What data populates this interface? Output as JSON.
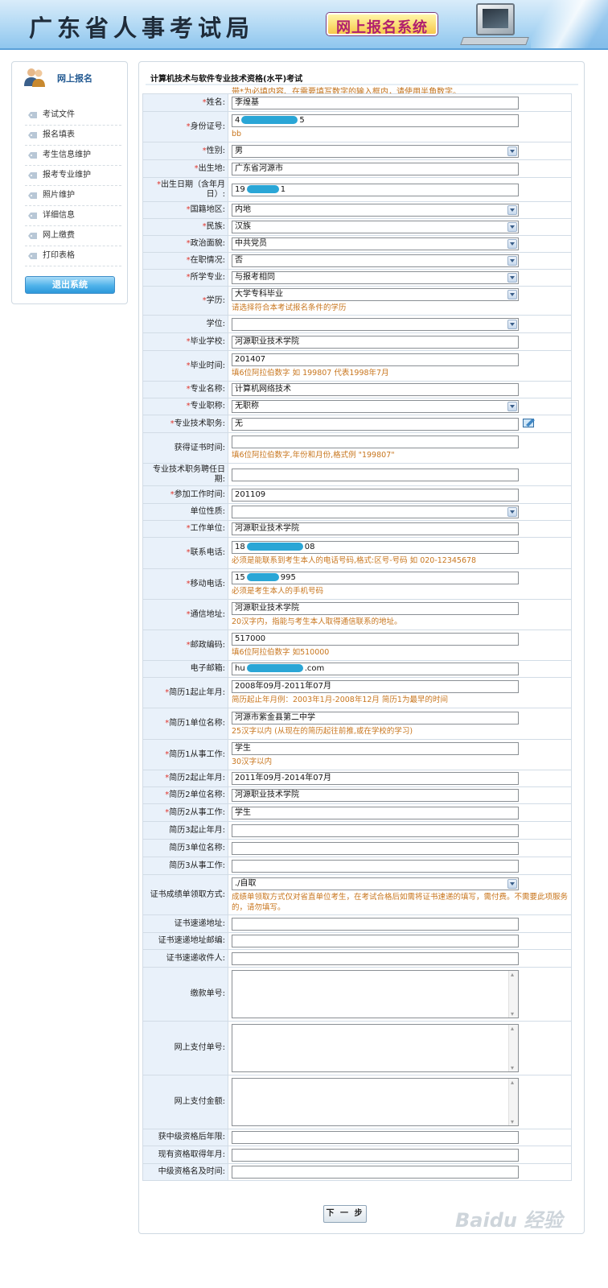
{
  "header": {
    "bureau_title": "广东省人事考试局",
    "system_badge": "网上报名系统"
  },
  "sidebar": {
    "title": "网上报名",
    "items": [
      {
        "label": "考试文件"
      },
      {
        "label": "报名填表"
      },
      {
        "label": "考生信息维护"
      },
      {
        "label": "报考专业维护"
      },
      {
        "label": "照片维护"
      },
      {
        "label": "详细信息"
      },
      {
        "label": "网上缴费"
      },
      {
        "label": "打印表格"
      }
    ],
    "logout_label": "退出系统"
  },
  "main": {
    "title": "计算机技术与软件专业技术资格(水平)考试",
    "note": "带*为必填内容、在需要填写数字的输入框内，请使用半角数字。"
  },
  "form": {
    "name": {
      "label": "姓名:",
      "value": "李煌基"
    },
    "id_number": {
      "label": "身份证号:",
      "prefix": "4",
      "suffix": "5",
      "hint": "bb"
    },
    "gender": {
      "label": "性别:",
      "value": "男"
    },
    "birthplace": {
      "label": "出生地:",
      "value": "广东省河源市"
    },
    "birthdate": {
      "label": "出生日期（含年月日）:",
      "prefix": "19",
      "suffix": "1"
    },
    "nationality_region": {
      "label": "国籍地区:",
      "value": "内地"
    },
    "ethnicity": {
      "label": "民族:",
      "value": "汉族"
    },
    "political_status": {
      "label": "政治面貌:",
      "value": "中共党员"
    },
    "employment_status": {
      "label": "在职情况:",
      "value": "否"
    },
    "major_relation": {
      "label": "所学专业:",
      "value": "与报考相同"
    },
    "education": {
      "label": "学历:",
      "value": "大学专科毕业",
      "hint": "请选择符合本考试报名条件的学历"
    },
    "degree": {
      "label": "学位:",
      "value": ""
    },
    "school": {
      "label": "毕业学校:",
      "value": "河源职业技术学院"
    },
    "grad_time": {
      "label": "毕业时间:",
      "value": "201407",
      "hint": "填6位阿拉伯数字 如 199807 代表1998年7月"
    },
    "major_name": {
      "label": "专业名称:",
      "value": "计算机网络技术"
    },
    "prof_title": {
      "label": "专业职称:",
      "value": "无职称"
    },
    "tech_position": {
      "label": "专业技术职务:",
      "value": "无"
    },
    "cert_time": {
      "label": "获得证书时间:",
      "value": "",
      "hint": "填6位阿拉伯数字,年份和月份,格式例 \"199807\""
    },
    "appointment_date": {
      "label": "专业技术职务聘任日期:",
      "value": ""
    },
    "work_start": {
      "label": "参加工作时间:",
      "value": "201109"
    },
    "unit_nature": {
      "label": "单位性质:",
      "value": ""
    },
    "work_unit": {
      "label": "工作单位:",
      "value": "河源职业技术学院"
    },
    "phone": {
      "label": "联系电话:",
      "prefix": "18",
      "suffix": "08",
      "hint": "必须是能联系到考生本人的电话号码,格式:区号-号码 如 020-12345678"
    },
    "mobile": {
      "label": "移动电话:",
      "prefix": "15",
      "suffix": "995",
      "hint": "必须是考生本人的手机号码"
    },
    "address": {
      "label": "通信地址:",
      "value": "河源职业技术学院",
      "hint": "20汉字内，指能与考生本人取得通信联系的地址。"
    },
    "postcode": {
      "label": "邮政编码:",
      "value": "517000",
      "hint": "填6位阿拉伯数字 如510000"
    },
    "email": {
      "label": "电子邮箱:",
      "prefix": "hu",
      "suffix": ".com"
    },
    "resume1_period": {
      "label": "简历1起止年月:",
      "value": "2008年09月-2011年07月",
      "hint": "简历起止年月例：2003年1月-2008年12月 简历1为最早的时间"
    },
    "resume1_unit": {
      "label": "简历1单位名称:",
      "value": "河源市紫金县第二中学",
      "hint": "25汉字以内 (从现在的简历起往前推,或在学校的学习)"
    },
    "resume1_job": {
      "label": "简历1从事工作:",
      "value": "学生",
      "hint": "30汉字以内"
    },
    "resume2_period": {
      "label": "简历2起止年月:",
      "value": "2011年09月-2014年07月"
    },
    "resume2_unit": {
      "label": "简历2单位名称:",
      "value": "河源职业技术学院"
    },
    "resume2_job": {
      "label": "简历2从事工作:",
      "value": "学生"
    },
    "resume3_period": {
      "label": "简历3起止年月:",
      "value": ""
    },
    "resume3_unit": {
      "label": "简历3单位名称:",
      "value": ""
    },
    "resume3_job": {
      "label": "简历3从事工作:",
      "value": ""
    },
    "cert_pickup": {
      "label": "证书成绩单领取方式:",
      "value": "./自取",
      "hint": "成绩单领取方式仅对省直单位考生，在考试合格后如需将证书速递的填写，需付费。不需要此项服务的，请勿填写。"
    },
    "cert_delivery_address": {
      "label": "证书速递地址:",
      "value": ""
    },
    "cert_delivery_postcode": {
      "label": "证书速递地址邮编:",
      "value": ""
    },
    "cert_delivery_recipient": {
      "label": "证书速递收件人:",
      "value": ""
    },
    "payment_slip": {
      "label": "缴款单号:",
      "value": ""
    },
    "online_payment_no": {
      "label": "网上支付单号:",
      "value": ""
    },
    "online_payment_amount": {
      "label": "网上支付金额:",
      "value": ""
    },
    "years_after_mid": {
      "label": "获中级资格后年限:",
      "value": ""
    },
    "current_qual_date": {
      "label": "现有资格取得年月:",
      "value": ""
    },
    "mid_qual_name_time": {
      "label": "中级资格名及时间:",
      "value": ""
    }
  },
  "footer": {
    "next_label": "下 一 步",
    "watermark": "Baidu 经验"
  },
  "colors": {
    "accent_blue": "#2d98da",
    "hint_orange": "#c8761e",
    "required_red": "#e0342b",
    "label_bg": "#e9f1fa",
    "redaction_blue": "#2aa6d6"
  },
  "icons": {
    "avatar": "users-icon",
    "menu": "tag-icon",
    "edit": "edit-icon",
    "dropdown": "chevron-down-icon"
  }
}
